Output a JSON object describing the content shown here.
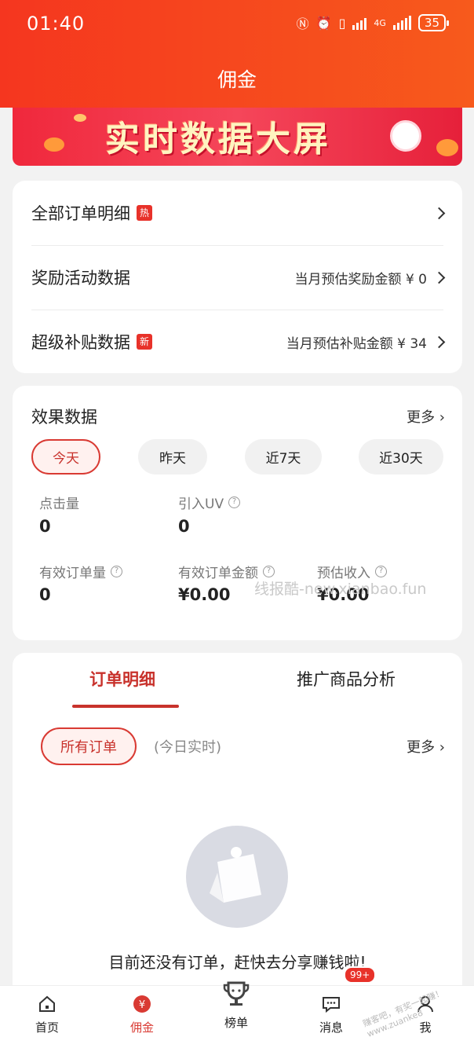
{
  "status_bar": {
    "time": "01:40",
    "network": "4G",
    "battery": "35"
  },
  "header": {
    "title": "佣金"
  },
  "banner": {
    "title": "实时数据大屏"
  },
  "menu": {
    "items": [
      {
        "label": "全部订单明细",
        "tag": "热",
        "right_text": ""
      },
      {
        "label": "奖励活动数据",
        "tag": "",
        "right_text": "当月预估奖励金额 ¥ 0"
      },
      {
        "label": "超级补贴数据",
        "tag": "新",
        "right_text": "当月预估补贴金额 ¥ 34"
      }
    ]
  },
  "effect": {
    "title": "效果数据",
    "more": "更多 ›",
    "ranges": [
      "今天",
      "昨天",
      "近7天",
      "近30天"
    ],
    "selected_range": "今天",
    "metrics": [
      {
        "label": "点击量",
        "value": "0"
      },
      {
        "label": "引入UV",
        "value": "0"
      },
      {
        "label": "有效订单量",
        "value": "0"
      },
      {
        "label": "有效订单金额",
        "value": "¥0.00"
      },
      {
        "label": "预估收入",
        "value": "¥0.00"
      }
    ],
    "watermark": "线报酷-new.xianbao.fun"
  },
  "orders": {
    "tabs": [
      "订单明细",
      "推广商品分析"
    ],
    "active_tab": "订单明细",
    "filter": "所有订单",
    "hint": "(今日实时)",
    "more": "更多 ›",
    "empty_text": "目前还没有订单，赶快去分享赚钱啦!"
  },
  "bottom_nav": {
    "items": [
      "首页",
      "佣金",
      "榜单",
      "消息",
      "我"
    ],
    "active": "佣金",
    "message_badge": "99+"
  },
  "corner_watermark": "赚客吧，有奖一起赚！ www.zuanke8"
}
